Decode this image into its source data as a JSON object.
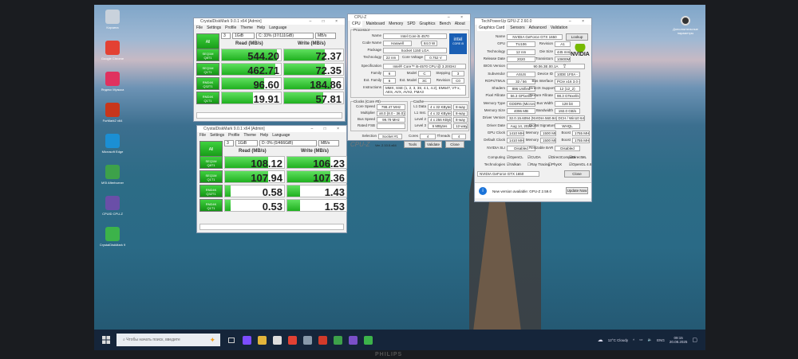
{
  "desktop": {
    "icons": [
      {
        "label": "Корзина",
        "color": "#c9d2dc"
      },
      {
        "label": "Google Chrome",
        "color": "#e34133"
      },
      {
        "label": "Яндекс Музыка",
        "color": "#e0325f"
      },
      {
        "label": "FurMark2 x64",
        "color": "#c8361b"
      },
      {
        "label": "Microsoft Edge",
        "color": "#1b8fd4"
      },
      {
        "label": "MSI Afterburner",
        "color": "#3da14a"
      },
      {
        "label": "CPUID CPU-Z",
        "color": "#6a4fa8"
      },
      {
        "label": "CrystalDiskMark 9",
        "color": "#3cb34a"
      }
    ],
    "right_icon": {
      "label": "Дополнительные параметры"
    }
  },
  "cdm1": {
    "title": "CrystalDiskMark 9.0.1 x64 [Admin]",
    "menu": [
      "File",
      "Settings",
      "Profile",
      "Theme",
      "Help",
      "Language"
    ],
    "all": "All",
    "count": "3",
    "size": "1GiB",
    "drive": "C: 33% (37/111GiB)",
    "unit": "MB/s",
    "read_hdr": "Read (MB/s)",
    "write_hdr": "Write (MB/s)",
    "rows": [
      {
        "l1": "SEQ1M",
        "l2": "Q8T1",
        "read": "544.20",
        "write": "72.37",
        "rv": 544.2,
        "wv": 72.37
      },
      {
        "l1": "SEQ1M",
        "l2": "Q1T1",
        "read": "462.71",
        "write": "72.35",
        "rv": 462.71,
        "wv": 72.35
      },
      {
        "l1": "RND4K",
        "l2": "Q32T1",
        "read": "96.60",
        "write": "184.86",
        "rv": 96.6,
        "wv": 184.86
      },
      {
        "l1": "RND4K",
        "l2": "Q1T1",
        "read": "19.91",
        "write": "57.81",
        "rv": 19.91,
        "wv": 57.81
      }
    ]
  },
  "cdm2": {
    "title": "CrystalDiskMark 9.0.1 x64 [Admin]",
    "menu": [
      "File",
      "Settings",
      "Profile",
      "Theme",
      "Help",
      "Language"
    ],
    "all": "All",
    "count": "3",
    "size": "1GiB",
    "drive": "D: 0% (0/466GiB)",
    "unit": "MB/s",
    "read_hdr": "Read (MB/s)",
    "write_hdr": "Write (MB/s)",
    "rows": [
      {
        "l1": "SEQ1M",
        "l2": "Q8T1",
        "read": "108.12",
        "write": "106.23",
        "rv": 108.12,
        "wv": 106.23
      },
      {
        "l1": "SEQ1M",
        "l2": "Q1T1",
        "read": "107.94",
        "write": "107.36",
        "rv": 107.94,
        "wv": 107.36
      },
      {
        "l1": "RND4K",
        "l2": "Q32T1",
        "read": "0.58",
        "write": "1.43",
        "rv": 0.58,
        "wv": 1.43
      },
      {
        "l1": "RND4K",
        "l2": "Q1T1",
        "read": "0.53",
        "write": "1.53",
        "rv": 0.53,
        "wv": 1.53
      }
    ]
  },
  "cpuz": {
    "title": "CPU-Z",
    "tabs": [
      "CPU",
      "Mainboard",
      "Memory",
      "SPD",
      "Graphics",
      "Bench",
      "About"
    ],
    "processor_group": "Processor",
    "clocks_group": "Clocks (Core #0)",
    "cache_group": "Cache",
    "name_l": "Name",
    "name": "Intel Core i5 4570",
    "code_l": "Code Name",
    "code": "Haswell",
    "tdp_l": "Max TDP",
    "tdp": "84.0 W",
    "pkg_l": "Package",
    "pkg": "Socket 1150 LGA",
    "tech_l": "Technology",
    "tech": "22 nm",
    "volt_l": "Core Voltage",
    "volt": "0.752 V",
    "spec_l": "Specification",
    "spec": "Intel® Core™ i5-4570 CPU @ 3.20GHz",
    "fam_l": "Family",
    "fam": "6",
    "model_l": "Model",
    "model": "C",
    "step_l": "Stepping",
    "step": "3",
    "efam_l": "Ext. Family",
    "efam": "6",
    "emodel_l": "Ext. Model",
    "emodel": "3C",
    "rev_l": "Revision",
    "rev": "C0",
    "instr_l": "Instructions",
    "instr": "MMX, SSE (1, 2, 3, 3S, 4.1, 4.2), EM64T, VT-x, AES, AVX, AVX2, FMA3",
    "cs_l": "Core Speed",
    "cs": "798.47 MHz",
    "mult_l": "Multiplier",
    "mult": "x8.0 (8.0 - 36.0)",
    "bus_l": "Bus Speed",
    "bus": "99.79 MHz",
    "fsb_l": "Rated FSB",
    "cache": [
      {
        "l": "L1 Data",
        "v": "4 x 32 KBytes",
        "w": "8-way"
      },
      {
        "l": "L1 Inst.",
        "v": "4 x 32 KBytes",
        "w": "8-way"
      },
      {
        "l": "Level 2",
        "v": "4 x 256 KBytes",
        "w": "8-way"
      },
      {
        "l": "Level 3",
        "v": "6 MBytes",
        "w": "12-way"
      }
    ],
    "sel_l": "Selection",
    "sel": "Socket #1",
    "cores_l": "Cores",
    "cores": "4",
    "thr_l": "Threads",
    "thr": "4",
    "brand": "CPU-Z",
    "ver": "Ver. 2.10.0.x64",
    "tools": "Tools",
    "validate": "Validate",
    "close": "Close",
    "intel": "intel",
    "intel_sub": "CORE i5"
  },
  "gpuz": {
    "title": "TechPowerUp GPU-Z 2.60.0",
    "tabs": [
      "Graphics Card",
      "Sensors",
      "Advanced",
      "Validation"
    ],
    "lookup": "Lookup",
    "nvidia": "NVIDIA",
    "rows": [
      [
        "Name",
        "NVIDIA GeForce GTX 1650"
      ],
      [
        "GPU",
        "TU106",
        "Revision",
        "A1"
      ],
      [
        "Technology",
        "12 nm",
        "Die Size",
        "445 mm²"
      ],
      [
        "Release Date",
        "2020",
        "Transistors",
        "10800M"
      ],
      [
        "BIOS Version",
        "90.06.3E.00.1A"
      ],
      [
        "Subvendor",
        "ASUS",
        "Device ID",
        "10DE 1F0A - 1043 8790"
      ],
      [
        "ROPs/TMUs",
        "32 / 56",
        "Bus Interface",
        "PCIe x16 3.0 @ x16 1.1"
      ],
      [
        "Shaders",
        "896 Unified",
        "DirectX Support",
        "12 (12_2)"
      ],
      [
        "Pixel Fillrate",
        "56.3 GPixel/s",
        "Texture Fillrate",
        "98.3 GTexel/s"
      ],
      [
        "Memory Type",
        "GDDR6 (Micron)",
        "Bus Width",
        "128 bit"
      ],
      [
        "Memory Size",
        "4096 MB",
        "Bandwidth",
        "192.0 GB/s"
      ],
      [
        "Driver Version",
        "32.0.15.6094 (NVIDIA 560.94) DCH / Win10 64"
      ],
      [
        "Driver Date",
        "Aug 14, 2024",
        "Digital Signature",
        "WHQL"
      ],
      [
        "GPU Clock",
        "1410 MHz",
        "Memory",
        "1500 MHz",
        "Boost",
        "1755 MHz"
      ],
      [
        "Default Clock",
        "1410 MHz",
        "Memory",
        "1500 MHz",
        "Boost",
        "1755 MHz"
      ],
      [
        "NVIDIA SLI",
        "Disabled",
        "Resizable BAR",
        "Disabled"
      ]
    ],
    "computing_l": "Computing",
    "computing": [
      "OpenCL",
      "CUDA",
      "DirectCompute",
      "DirectML"
    ],
    "tech_l": "Technologies",
    "technologies": [
      "Vulkan",
      "Ray Tracing",
      "PhysX",
      "OpenGL 4.6"
    ],
    "tech_checked": [
      true,
      false,
      false,
      true
    ],
    "device": "NVIDIA GeForce GTX 1650",
    "close": "Close",
    "notice": "New version available: GPU-Z 2.59.0",
    "update": "Update Now"
  },
  "taskbar": {
    "search_placeholder": "Чтобы начать поиск, введите",
    "weather": "12°C Cloudy",
    "lang": "ENG",
    "time": "09:15",
    "date": "20.08.2025",
    "apps": [
      "#7c4dff",
      "#e2b53b",
      "#dddddd",
      "#e34133",
      "#8899aa",
      "#d23a2a",
      "#3da14a",
      "#7a4fc8",
      "#3cb34a"
    ]
  },
  "monitor": {
    "brand": "PHILIPS"
  }
}
